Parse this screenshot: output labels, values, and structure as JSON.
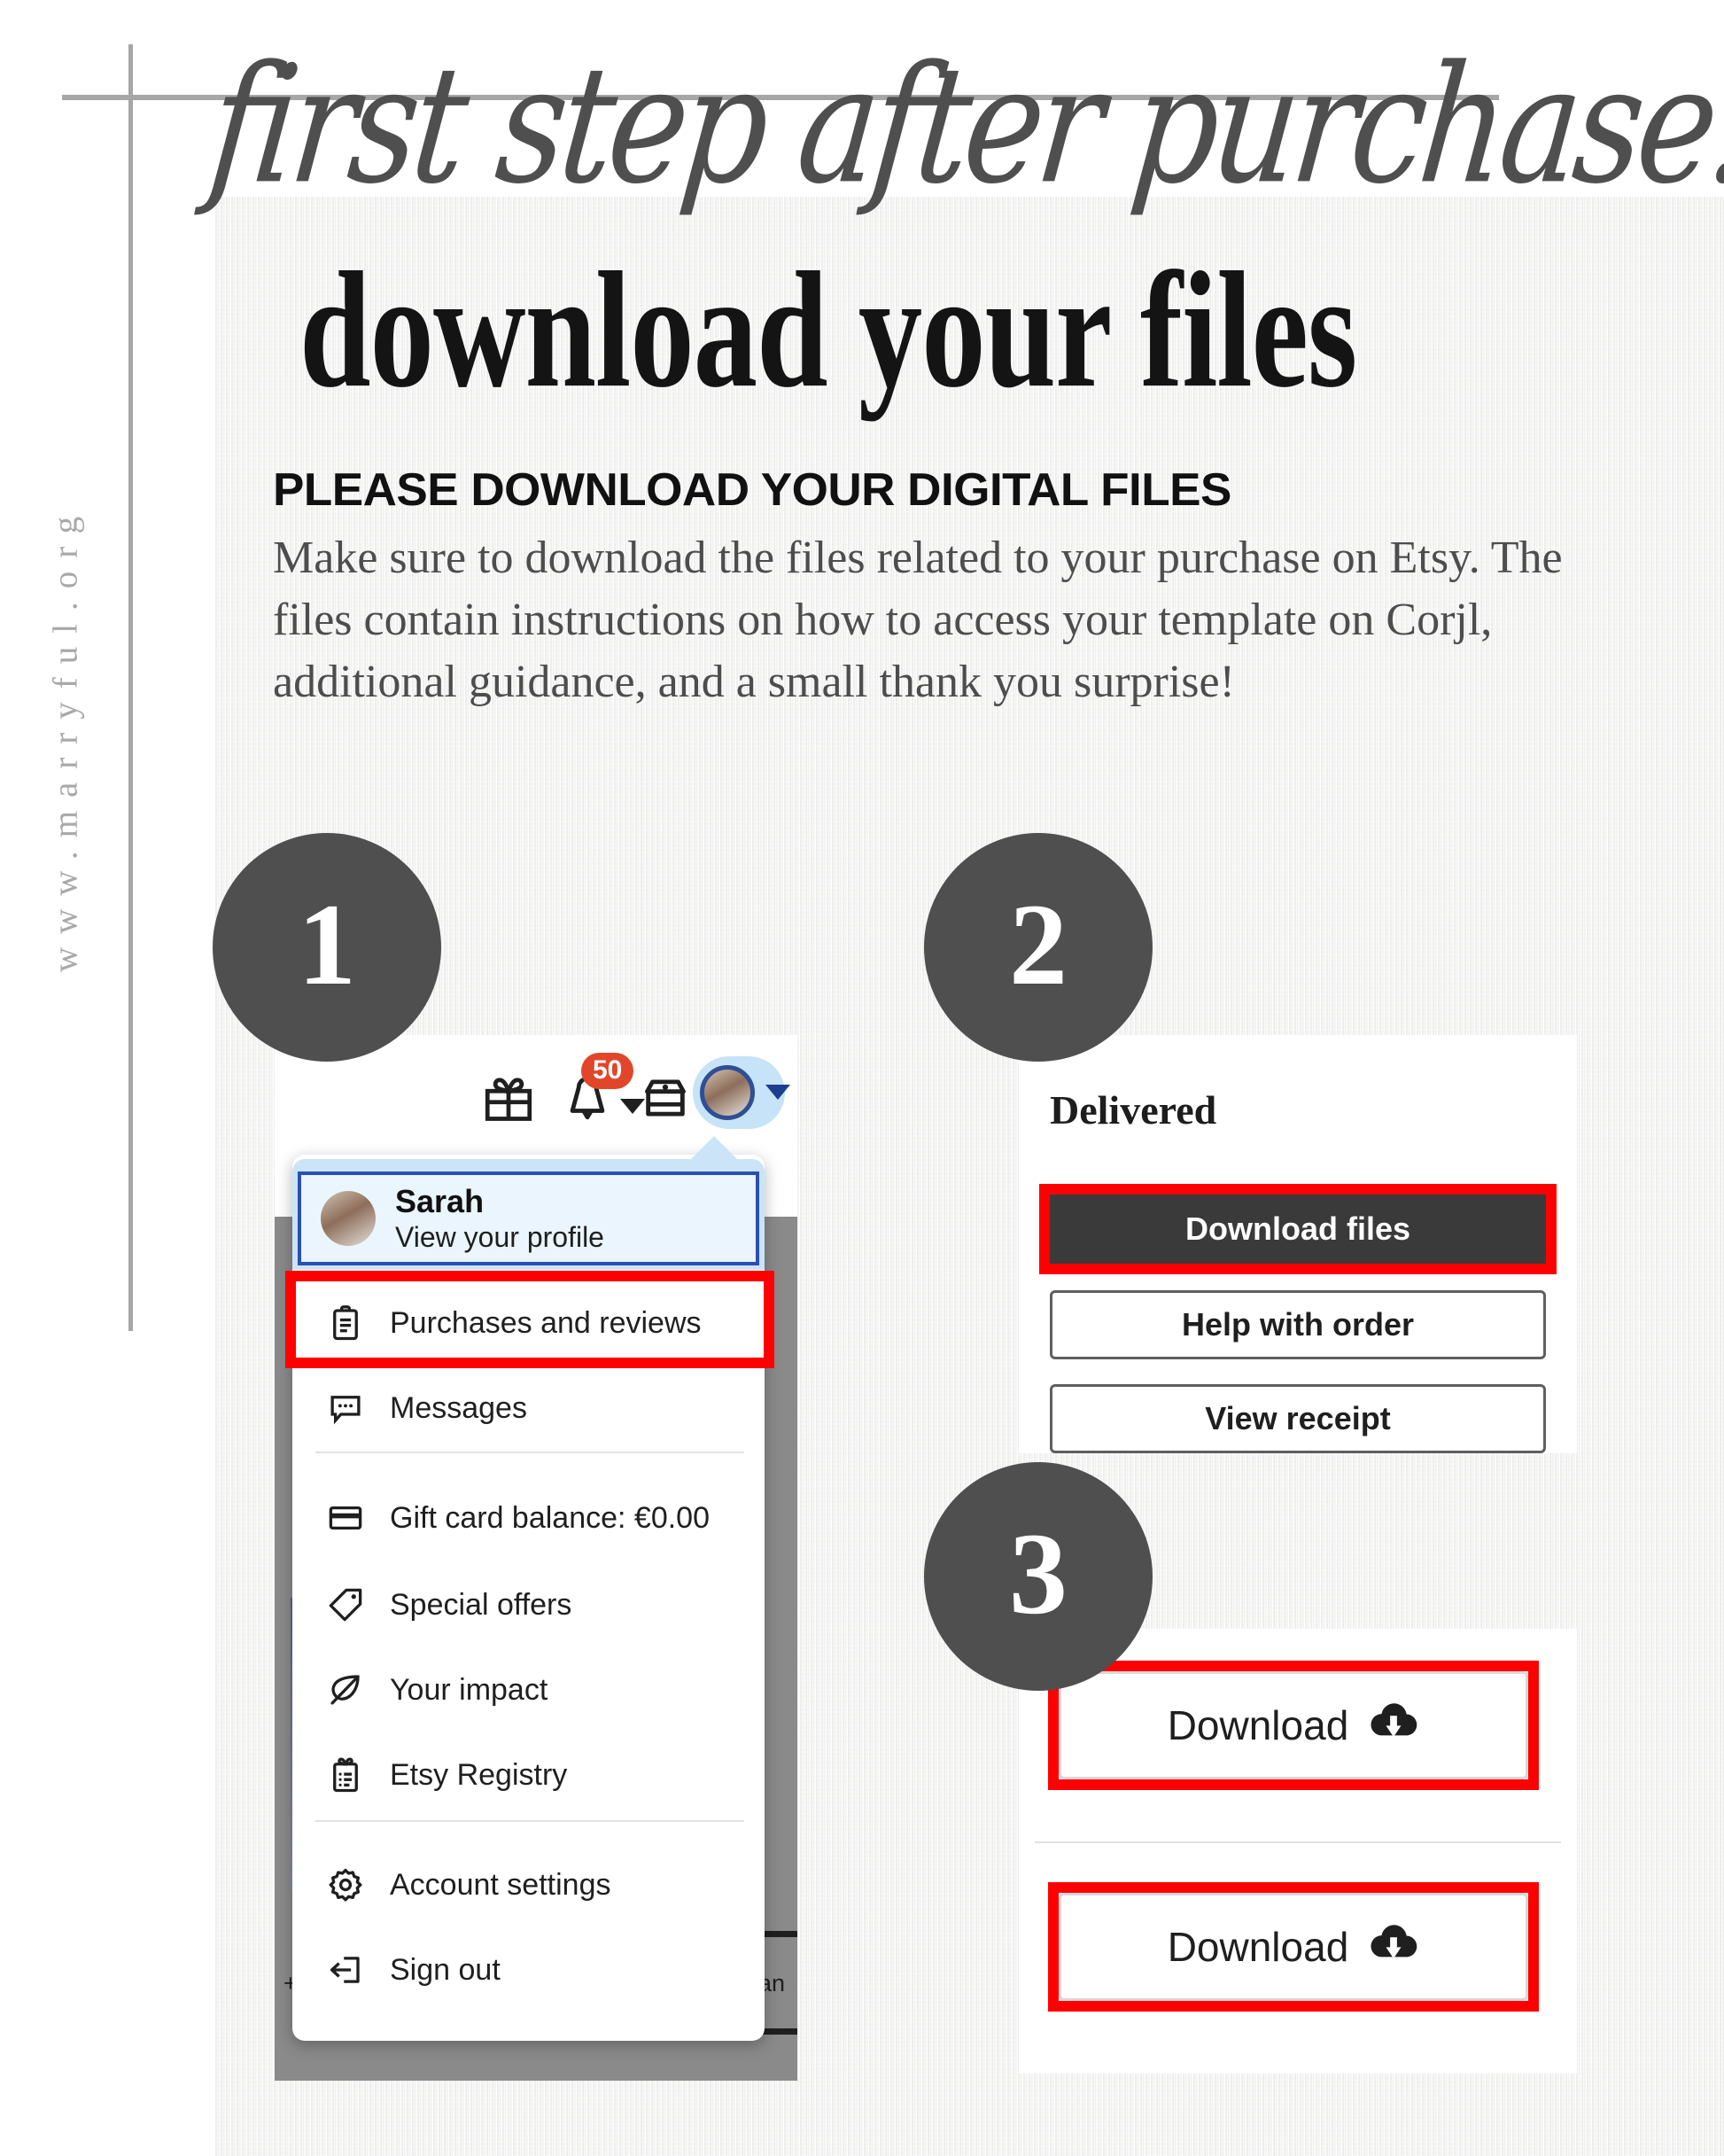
{
  "branding": {
    "vertical_url": "www.marryful.org"
  },
  "header": {
    "script_title": "first step after purchase:",
    "main_title": "download your files"
  },
  "intro": {
    "subhead": "PLEASE DOWNLOAD YOUR DIGITAL FILES",
    "body": "Make sure to download the files related to your purchase on Etsy. The files contain instructions on how to access your template on Corjl, additional guidance, and a small thank you surprise!"
  },
  "steps": {
    "one": "1",
    "two": "2",
    "three": "3"
  },
  "step1": {
    "topbar": {
      "gift_icon": "gift-icon",
      "bell_icon": "bell-icon",
      "notification_count": "50",
      "shop_icon": "shop-icon",
      "avatar_icon": "avatar-icon"
    },
    "profile": {
      "name": "Sarah",
      "subtitle": "View your profile"
    },
    "menu_items": [
      {
        "label": "Purchases and reviews",
        "icon": "clipboard-icon",
        "highlighted": true
      },
      {
        "label": "Messages",
        "icon": "message-bubble-icon",
        "highlighted": false
      },
      {
        "label": "Gift card balance: €0.00",
        "icon": "credit-card-icon",
        "highlighted": false
      },
      {
        "label": "Special offers",
        "icon": "price-tag-icon",
        "highlighted": false
      },
      {
        "label": "Your impact",
        "icon": "leaf-icon",
        "highlighted": false
      },
      {
        "label": "Etsy Registry",
        "icon": "registry-clipboard-icon",
        "highlighted": false
      },
      {
        "label": "Account settings",
        "icon": "gear-icon",
        "highlighted": false
      },
      {
        "label": "Sign out",
        "icon": "sign-out-icon",
        "highlighted": false
      }
    ],
    "page_fragments": {
      "left": "+ r",
      "right": "an"
    }
  },
  "step2": {
    "status": "Delivered",
    "buttons": [
      {
        "label": "Download files",
        "style": "primary",
        "highlighted": true
      },
      {
        "label": "Help with order",
        "style": "secondary",
        "highlighted": false
      },
      {
        "label": "View receipt",
        "style": "secondary",
        "highlighted": false
      }
    ]
  },
  "step3": {
    "buttons": [
      {
        "label": "Download",
        "icon": "cloud-download-icon",
        "highlighted": true
      },
      {
        "label": "Download",
        "icon": "cloud-download-icon",
        "highlighted": true
      }
    ]
  },
  "colors": {
    "highlight_red": "#FF0000",
    "badge_orange": "#E1462B",
    "step_circle_gray": "#4F4F4F",
    "rule_gray": "#A6A6A6",
    "etsy_blue": "#2B4FB5",
    "profile_band": "#CBE4F8"
  }
}
